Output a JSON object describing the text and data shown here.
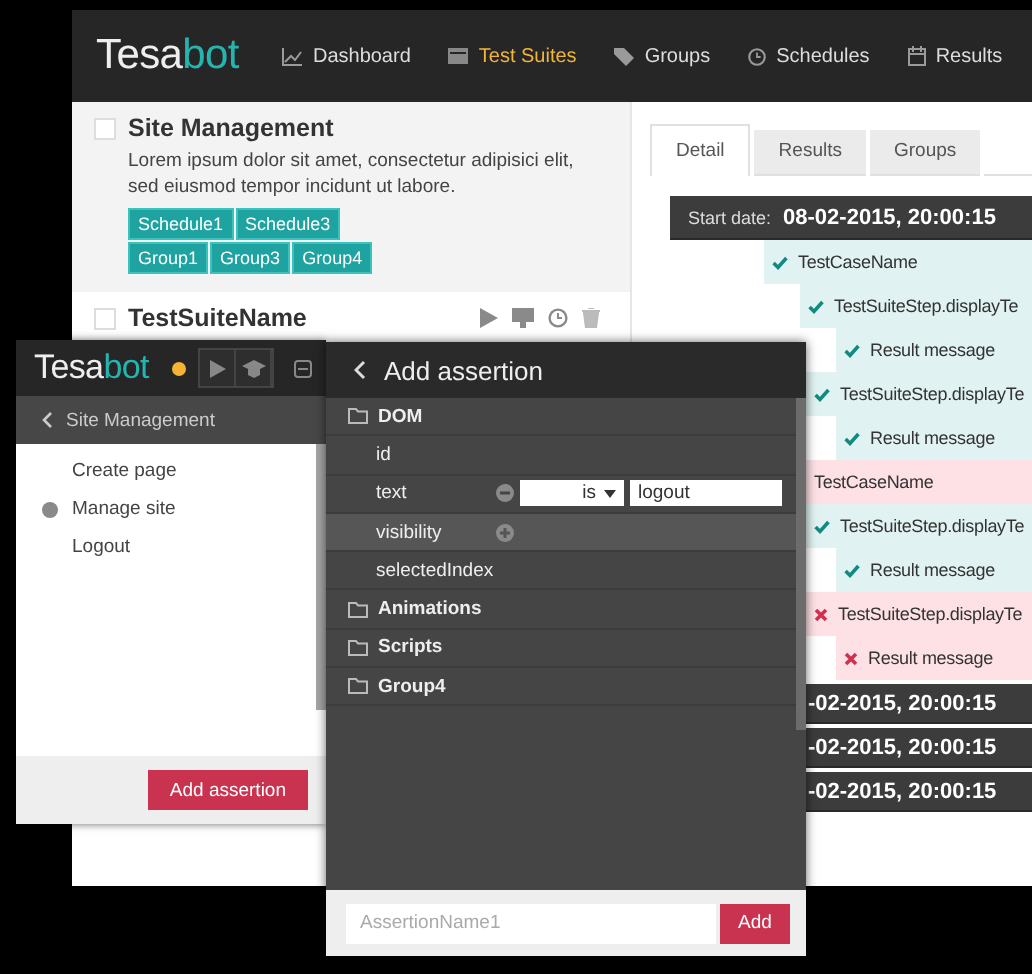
{
  "app": {
    "logo": {
      "text": "Tesa",
      "accent": "bot"
    },
    "nav": {
      "items": [
        {
          "label": "Dashboard",
          "selected": false
        },
        {
          "label": "Test Suites",
          "selected": true
        },
        {
          "label": "Groups",
          "selected": false
        },
        {
          "label": "Schedules",
          "selected": false
        },
        {
          "label": "Results",
          "selected": false
        }
      ]
    },
    "suites": [
      {
        "kind": "detail",
        "name": "Site Management",
        "description": "Lorem ipsum dolor sit amet, consectetur adipisici elit, sed eiusmod tempor incidunt ut labore.",
        "selected": true,
        "checked": false,
        "tag_rows": [
          [
            "Schedule1",
            "Schedule3"
          ],
          [
            "Group1",
            "Group3",
            "Group4"
          ]
        ]
      },
      {
        "kind": "row",
        "name": "TestSuiteName",
        "selected": false,
        "checked": false
      }
    ],
    "tabs": [
      {
        "label": "Detail",
        "selected": true
      },
      {
        "label": "Results",
        "selected": false
      },
      {
        "label": "Groups",
        "selected": false
      }
    ],
    "results": {
      "runs": [
        {
          "label": "Start date:",
          "date": "08-02-2015, 20:00:15",
          "cases": [
            {
              "name": "TestCaseName",
              "passed": true,
              "children": [
                {
                  "name": "TestSuiteStep.displayTe",
                  "passed": true,
                  "children": [
                    {
                      "name": "Result message",
                      "passed": true
                    }
                  ]
                },
                {
                  "name": "TestSuiteStep.displayTe",
                  "passed": true,
                  "children": [
                    {
                      "name": "Result message",
                      "passed": true
                    }
                  ]
                }
              ]
            },
            {
              "name": "TestCaseName",
              "passed": false,
              "children": [
                {
                  "name": "TestSuiteStep.displayTe",
                  "passed": true,
                  "children": [
                    {
                      "name": "Result message",
                      "passed": true
                    }
                  ]
                },
                {
                  "name": "TestSuiteStep.displayTe",
                  "passed": false,
                  "children": [
                    {
                      "name": "Result message",
                      "passed": false
                    }
                  ]
                }
              ]
            }
          ]
        },
        {
          "date": "-02-2015, 20:00:15"
        },
        {
          "date": "-02-2015, 20:00:15"
        },
        {
          "date": "-02-2015, 20:00:15"
        }
      ]
    }
  },
  "extension": {
    "logo": {
      "text": "Tesa",
      "accent": "bot"
    },
    "breadcrumb": "Site Management",
    "items": [
      {
        "label": "Create page",
        "current": false
      },
      {
        "label": "Manage site",
        "current": true
      },
      {
        "label": "Logout",
        "current": false
      }
    ],
    "button": "Add assertion"
  },
  "assertion": {
    "title": "Add assertion",
    "groups": [
      {
        "name": "DOM",
        "children": [
          {
            "kind": "plain",
            "name": "id",
            "selected": false
          },
          {
            "kind": "condition",
            "name": "text",
            "selected": false,
            "operator": "is",
            "value": "logout"
          },
          {
            "kind": "addable",
            "name": "visibility",
            "selected": true
          },
          {
            "kind": "plain",
            "name": "selectedIndex",
            "selected": false
          }
        ]
      },
      {
        "name": "Animations"
      },
      {
        "name": "Scripts"
      },
      {
        "name": "Group4"
      }
    ],
    "name_field": {
      "placeholder": "AssertionName1"
    },
    "button": "Add"
  }
}
